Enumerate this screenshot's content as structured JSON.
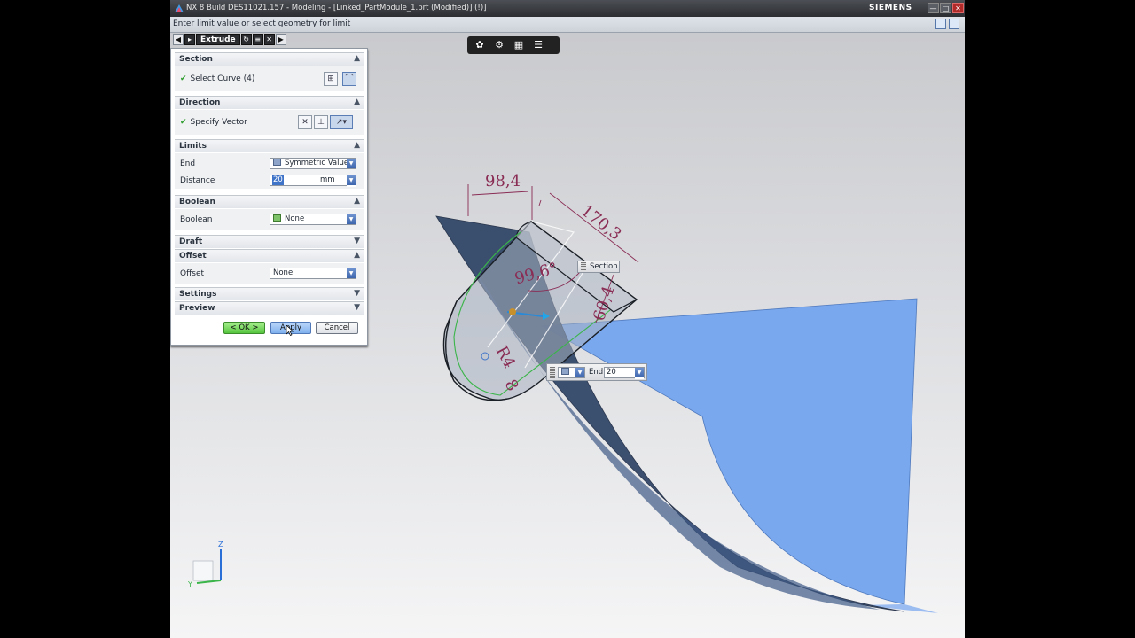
{
  "window": {
    "title": "NX 8  Build DES11021.157 - Modeling - [Linked_PartModule_1.prt (Modified)]   (!)]",
    "brand": "SIEMENS",
    "controls": [
      "—",
      "□",
      "✕"
    ]
  },
  "cue_line": "Enter limit value or select geometry for limit",
  "view_toolbar": [
    "selection-filter-icon",
    "gear-icon",
    "grid-icon",
    "menu-icon"
  ],
  "dialog": {
    "title": "Extrude",
    "header_buttons": [
      "◀",
      "▸",
      "↻",
      "≡",
      "✕",
      "▶"
    ],
    "sections": {
      "section": {
        "label": "Section",
        "row_label": "Select Curve (4)"
      },
      "direction": {
        "label": "Direction",
        "row_label": "Specify Vector"
      },
      "limits": {
        "label": "Limits",
        "end_label": "End",
        "end_value": "Symmetric Value",
        "distance_label": "Distance",
        "distance_value": "20",
        "distance_unit": "mm"
      },
      "boolean": {
        "label": "Boolean",
        "row_label": "Boolean",
        "value": "None"
      },
      "draft": {
        "label": "Draft"
      },
      "offset": {
        "label": "Offset",
        "row_label": "Offset",
        "value": "None"
      },
      "settings": {
        "label": "Settings"
      },
      "preview": {
        "label": "Preview"
      }
    },
    "buttons": {
      "ok": "< OK >",
      "apply": "Apply",
      "cancel": "Cancel"
    }
  },
  "canvas": {
    "dimensions": {
      "width_top": "98,4",
      "length": "170,3",
      "angle": "99,6°",
      "height": "60,4",
      "radius": "R4",
      "radius_value": "8"
    },
    "section_tag": "Section",
    "end_handle": {
      "label": "End",
      "value": "20"
    },
    "axis_labels": {
      "z": "Z",
      "y": "Y"
    }
  },
  "colors": {
    "title_bar": "#2f3237",
    "viewport_top": "#c9cacd",
    "surface_blue": "#7aa8ee",
    "surface_dark": "#2f4466",
    "dimension": "#8a2d55",
    "ok_green": "#55c43d",
    "apply_blue": "#7fb0ee"
  }
}
